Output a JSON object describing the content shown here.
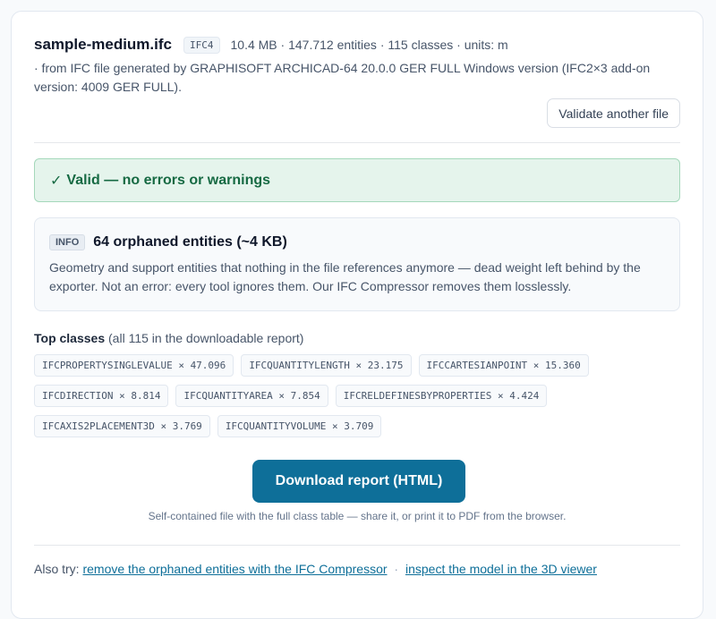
{
  "file": {
    "name": "sample-medium.ifc",
    "schema": "IFC4",
    "meta": "10.4 MB · 147.712 entities · 115 classes · units: m",
    "origin": "· from IFC file generated by GRAPHISOFT ARCHICAD-64 20.0.0 GER FULL Windows version (IFC2×3 add-on version: 4009 GER FULL)."
  },
  "actions": {
    "validate_another": "Validate another file"
  },
  "validation": {
    "status_icon": "✓",
    "message": "Valid — no errors or warnings",
    "color": "#166a43"
  },
  "info": {
    "badge": "INFO",
    "title": "64 orphaned entities (~4 KB)",
    "body": "Geometry and support entities that nothing in the file references anymore — dead weight left behind by the exporter. Not an error: every tool ignores them. Our IFC Compressor removes them losslessly."
  },
  "top_classes": {
    "label": "Top classes",
    "note": "(all 115 in the downloadable report)",
    "items": [
      "IFCPROPERTYSINGLEVALUE × 47.096",
      "IFCQUANTITYLENGTH × 23.175",
      "IFCCARTESIANPOINT × 15.360",
      "IFCDIRECTION × 8.814",
      "IFCQUANTITYAREA × 7.854",
      "IFCRELDEFINESBYPROPERTIES × 4.424",
      "IFCAXIS2PLACEMENT3D × 3.769",
      "IFCQUANTITYVOLUME × 3.709"
    ]
  },
  "download": {
    "label": "Download report (HTML)",
    "note": "Self-contained file with the full class table — share it, or print it to PDF from the browser.",
    "color": "#0e6f99"
  },
  "also_try": {
    "prefix": "Also try:",
    "link1": "remove the orphaned entities with the IFC Compressor",
    "separator": "·",
    "link2": "inspect the model in the 3D viewer"
  }
}
